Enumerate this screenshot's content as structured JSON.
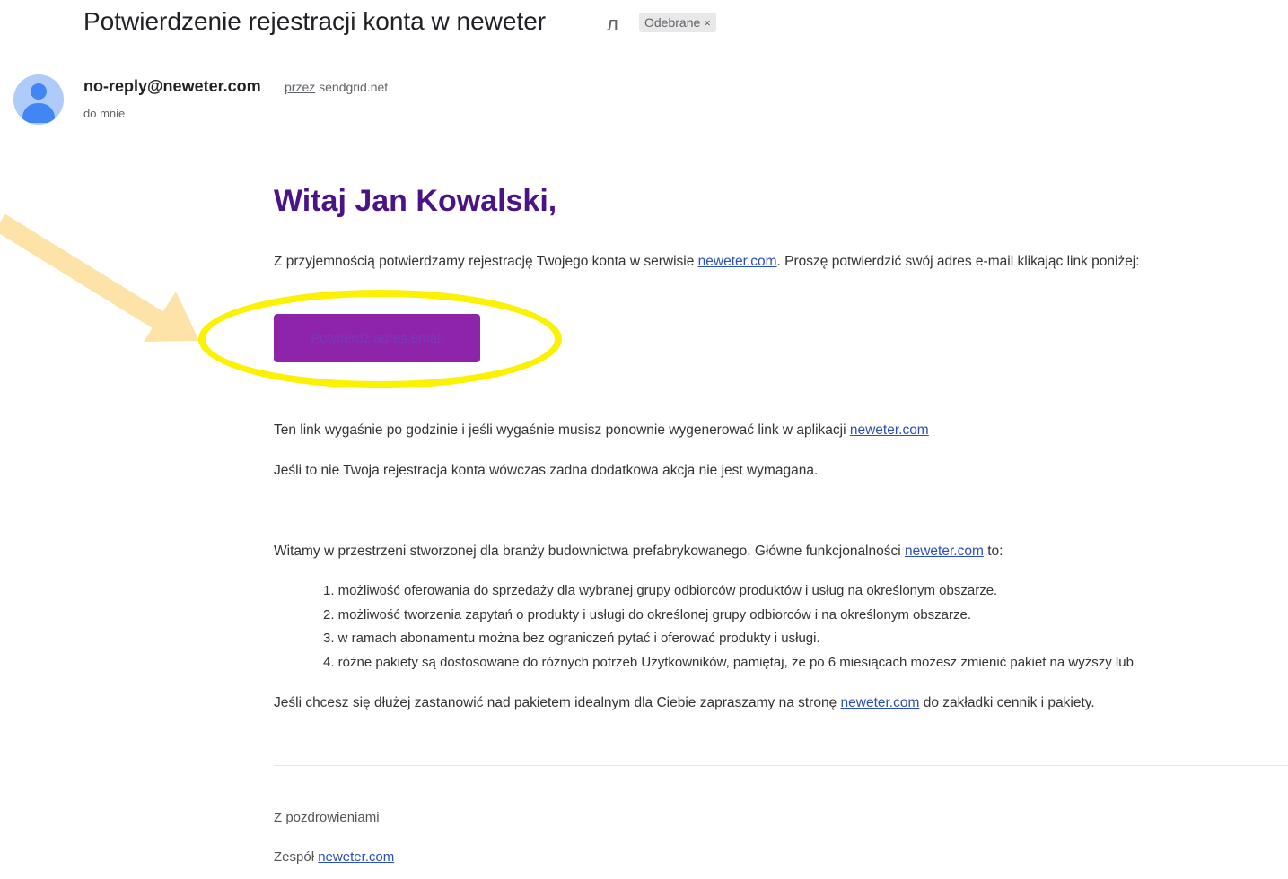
{
  "header": {
    "subject": "Potwierdzenie rejestracji konta w neweter",
    "label_chip": "Odebrane",
    "label_close": "×"
  },
  "sender": {
    "email": "no-reply@neweter.com",
    "via_word": "przez",
    "via_domain": "sendgrid.net",
    "to_line": "do mnie"
  },
  "email_body": {
    "greeting": "Witaj Jan Kowalski,",
    "intro_before": "Z przyjemnością potwierdzamy rejestrację Twojego konta w serwisie ",
    "intro_link": "neweter.com",
    "intro_after": ". Proszę potwierdzić swój adres e-mail klikając link poniżej:",
    "confirm_button": "Potwierdź adres email",
    "expire_before": "Ten link wygaśnie po godzinie i jeśli wygaśnie musisz ponownie wygenerować link w aplikacji ",
    "expire_link": "neweter.com",
    "not_you": "Jeśli to nie Twoja rejestracja konta wówczas zadna dodatkowa akcja nie jest wymagana.",
    "welcome_before": "Witamy w przestrzeni stworzonej dla branży budownictwa prefabrykowanego. Główne funkcjonalności ",
    "welcome_link": "neweter.com",
    "welcome_after": " to:",
    "features": [
      "1. możliwość oferowania do sprzedaży dla wybranej grupy odbiorców produktów i usług na określonym obszarze.",
      "2. możliwość tworzenia zapytań o produkty i usługi do określonej grupy odbiorców i na określonym obszarze.",
      "3. w ramach abonamentu można bez ograniczeń pytać i oferować produkty i usługi.",
      "4. różne pakiety są dostosowane do różnych potrzeb Użytkowników, pamiętaj, że po 6 miesiącach możesz zmienić pakiet na wyższy lub"
    ],
    "pricing_before": "Jeśli chcesz się dłużej zastanowić nad pakietem idealnym dla Ciebie zapraszamy na stronę ",
    "pricing_link": "neweter.com",
    "pricing_after": " do zakładki cennik i pakiety.",
    "regards": "Z pozdrowieniami",
    "team_before": "Zespół ",
    "team_link": "neweter.com"
  },
  "colors": {
    "greeting": "#4a1486",
    "button": "#8e24aa",
    "highlight_ring": "#fbf100",
    "arrow": "#fde3a7",
    "link": "#2a4fb8"
  },
  "icons": [
    "important-marker-icon",
    "avatar-person-icon",
    "annotation-arrow-icon"
  ]
}
